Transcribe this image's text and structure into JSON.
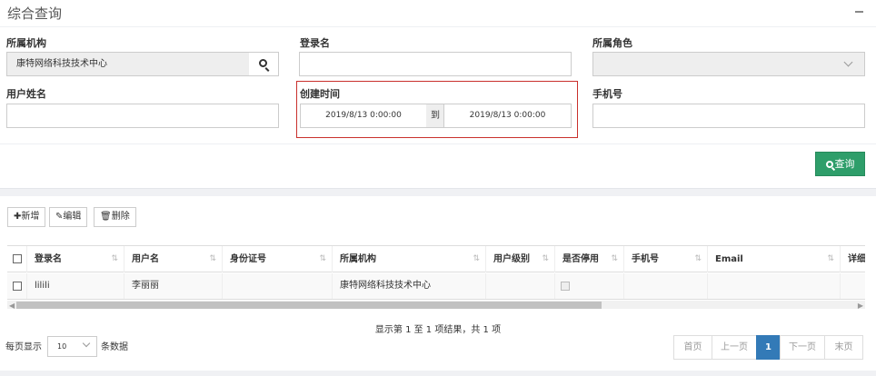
{
  "search_panel": {
    "title": "综合查询",
    "org_label": "所属机构",
    "org_value": "康特网络科技技术中心",
    "login_label": "登录名",
    "login_value": "",
    "role_label": "所属角色",
    "role_value": "",
    "username_label": "用户姓名",
    "username_value": "",
    "created_label": "创建时间",
    "created_from": "2019/8/13 0:00:00",
    "created_to_sep": "到",
    "created_to": "2019/8/13 0:00:00",
    "phone_label": "手机号",
    "phone_value": "",
    "query_button": "查询",
    "highlight_color": "#c9302c",
    "query_button_color": "#2e9e6a"
  },
  "toolbar": {
    "add": "新增",
    "edit": "编辑",
    "delete": "删除"
  },
  "table": {
    "columns": [
      "登录名",
      "用户名",
      "身份证号",
      "所属机构",
      "用户级别",
      "是否停用",
      "手机号",
      "Email",
      "详细"
    ],
    "rows": [
      {
        "login": "lilili",
        "username": "李丽丽",
        "id_number": "",
        "org": "康特网络科技技术中心",
        "level": "",
        "disabled": false,
        "phone": "",
        "email": "",
        "detail": ""
      }
    ]
  },
  "footer": {
    "info": "显示第 1 至 1 项结果，共 1 项",
    "page_size_prefix": "每页显示",
    "page_size_value": "10",
    "page_size_suffix": "条数据",
    "pager": {
      "first": "首页",
      "prev": "上一页",
      "current": "1",
      "next": "下一页",
      "last": "末页",
      "active_color": "#337ab7"
    }
  }
}
